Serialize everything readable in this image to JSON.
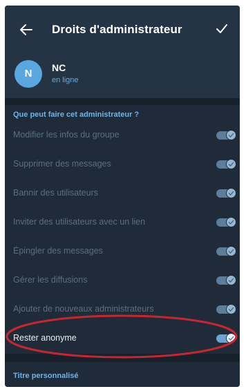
{
  "appbar": {
    "title": "Droits d'administrateur",
    "back_icon": "arrow-left-icon",
    "confirm_icon": "checkmark-icon"
  },
  "user": {
    "avatar_letter": "N",
    "name": "NC",
    "status": "en ligne",
    "avatar_color": "#5aa7df"
  },
  "permissions": {
    "header": "Que peut faire cet administrateur ?",
    "items": [
      {
        "label": "Modifier les infos du groupe",
        "enabled": true
      },
      {
        "label": "Supprimer des messages",
        "enabled": true
      },
      {
        "label": "Bannir des utilisateurs",
        "enabled": true
      },
      {
        "label": "Inviter des utilisateurs avec un lien",
        "enabled": true
      },
      {
        "label": "Épingler des messages",
        "enabled": true
      },
      {
        "label": "Gérer les diffusions",
        "enabled": true
      },
      {
        "label": "Ajouter de nouveaux administrateurs",
        "enabled": true
      },
      {
        "label": "Rester anonyme",
        "enabled": true
      }
    ]
  },
  "custom_title": {
    "header": "Titre personnalisé"
  },
  "colors": {
    "background": "#1f2b38",
    "accent": "#6fb3ea",
    "highlight_circle": "#c8262e"
  }
}
